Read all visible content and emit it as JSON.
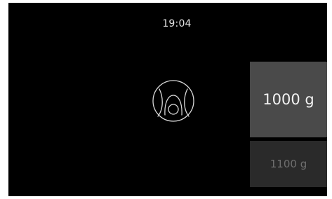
{
  "status_bar": {
    "time": "19:04"
  },
  "program": {
    "icon": "baking-program-icon"
  },
  "weight_selector": {
    "selected": "1000 g",
    "next": "1100 g"
  },
  "colors": {
    "background": "#000000",
    "selected_tile": "#4a4a4a",
    "next_tile": "#2a2a2a",
    "icon_stroke": "#d8d8d8"
  }
}
